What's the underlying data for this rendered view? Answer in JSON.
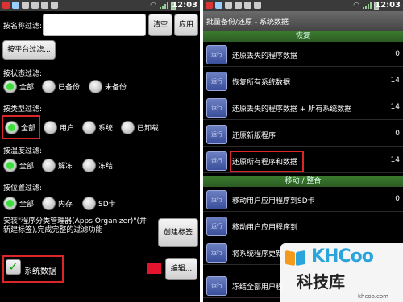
{
  "status_time": "12:03",
  "left": {
    "name_filter_label": "按名称过滤:",
    "name_filter_value": "",
    "clear_label": "清空",
    "apply_label": "应用",
    "platform_filter_label": "按平台过滤...",
    "status_filter_label": "按状态过滤:",
    "status_options": [
      "全部",
      "已备份",
      "未备份"
    ],
    "type_filter_label": "按类型过滤:",
    "type_options": [
      "全部",
      "用户",
      "系统",
      "已卸载"
    ],
    "temp_filter_label": "按温度过滤:",
    "temp_options": [
      "全部",
      "解冻",
      "冻结"
    ],
    "location_filter_label": "按位置过滤:",
    "location_options": [
      "全部",
      "内存",
      "SD卡"
    ],
    "install_note": "安装\"程序分类管理器(Apps Organizer)\"(并新建标签),完成完整的过滤功能",
    "create_tag_label": "创建标签",
    "system_data_label": "系统数据",
    "edit_label": "编辑..."
  },
  "right": {
    "title": "批量备份/还原 - 系统数据",
    "run_label": "运行",
    "section_restore": "恢复",
    "section_move": "移动 / 整合",
    "rows": [
      {
        "label": "还原丢失的程序数据",
        "count": "0"
      },
      {
        "label": "恢复所有系统数据",
        "count": "14"
      },
      {
        "label": "还原丢失的程序数据 + 所有系统数据",
        "count": "14"
      },
      {
        "label": "还原新版程序",
        "count": "0"
      },
      {
        "label": "还原所有程序和数据",
        "count": "14"
      },
      {
        "label": "移动用户应用程序到SD卡",
        "count": "0"
      },
      {
        "label": "移动用户应用程序到",
        "count": ""
      },
      {
        "label": "将系统程序更新",
        "count": ""
      },
      {
        "label": "冻结全部用户程",
        "count": ""
      }
    ]
  },
  "watermark": {
    "logo": "KHCoo",
    "name": "科技库",
    "url": "khcoo.com"
  }
}
